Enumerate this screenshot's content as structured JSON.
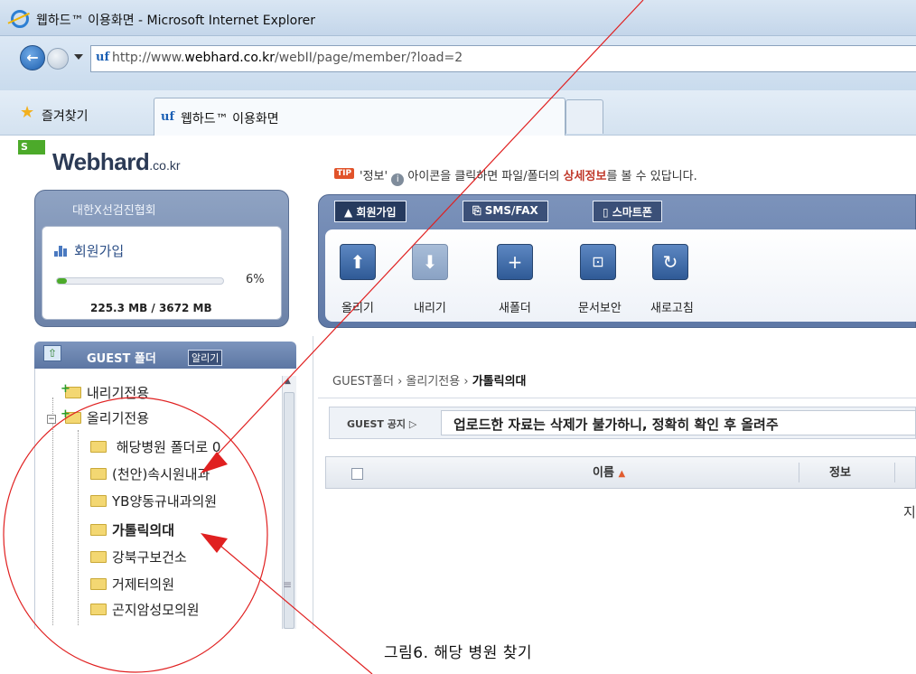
{
  "window": {
    "title": "웹하드™ 이용화면 - Microsoft Internet Explorer",
    "url_prefix": "http://www.",
    "url_domain": "webhard.co.kr",
    "url_path": "/webII/page/member/?load=2",
    "favorites_label": "즐겨찾기",
    "tab_label": "웹하드™ 이용화면"
  },
  "site": {
    "badge": "S",
    "logo": "Webhard",
    "logo_suffix": ".co.kr"
  },
  "tip": {
    "badge": "TIP",
    "info_word": "'정보'",
    "text_before": "아이콘을 클릭하면 파일/폴더의 ",
    "highlight": "상세정보",
    "text_after": "를 볼 수 있답니다."
  },
  "member": {
    "org": "대한X선검진협회",
    "label": "회원가입",
    "progress_percent": 6,
    "progress_text": "6%",
    "usage": "225.3 MB / 3672 MB"
  },
  "guest": {
    "title": "GUEST 폴더",
    "alarm_label": "알리기"
  },
  "tree": {
    "items": [
      {
        "label": "내리기전용"
      },
      {
        "label": "올리기전용"
      },
      {
        "label": "해당병원 폴더로 0"
      },
      {
        "label": "(천안)속시원내과"
      },
      {
        "label": "YB양동규내과의원"
      },
      {
        "label": "가톨릭의대"
      },
      {
        "label": "강북구보건소"
      },
      {
        "label": "거제터의원"
      },
      {
        "label": "곤지암성모의원"
      }
    ]
  },
  "tabs": [
    {
      "label": "회원가입",
      "icon": "person-icon"
    },
    {
      "label": "SMS/FAX",
      "icon": "phone-icon"
    },
    {
      "label": "스마트폰",
      "icon": "smartphone-icon"
    }
  ],
  "toolbar": [
    {
      "label": "올리기",
      "icon": "arrow-up-icon",
      "glyph": "⬆"
    },
    {
      "label": "내리기",
      "icon": "arrow-down-icon",
      "glyph": "⬇"
    },
    {
      "label": "새폴더",
      "icon": "new-folder-icon",
      "glyph": "+"
    },
    {
      "label": "문서보안",
      "icon": "lock-icon",
      "glyph": "🔒"
    },
    {
      "label": "새로고침",
      "icon": "refresh-icon",
      "glyph": "↻"
    }
  ],
  "breadcrumb": {
    "part1": "GUEST폴더",
    "part2": "올리기전용",
    "current": "가톨릭의대",
    "sep": "›"
  },
  "notice": {
    "label": "GUEST 공지",
    "text": "업로드한 자료는 삭제가 불가하니, 정확히 확인 후 올려주"
  },
  "file_list": {
    "col_name": "이름",
    "col_info": "정보",
    "cell_cut": "지"
  },
  "caption": "그림6. 해당 병원 찾기",
  "colors": {
    "annotation": "#e02020",
    "accent": "#4caa2a"
  }
}
